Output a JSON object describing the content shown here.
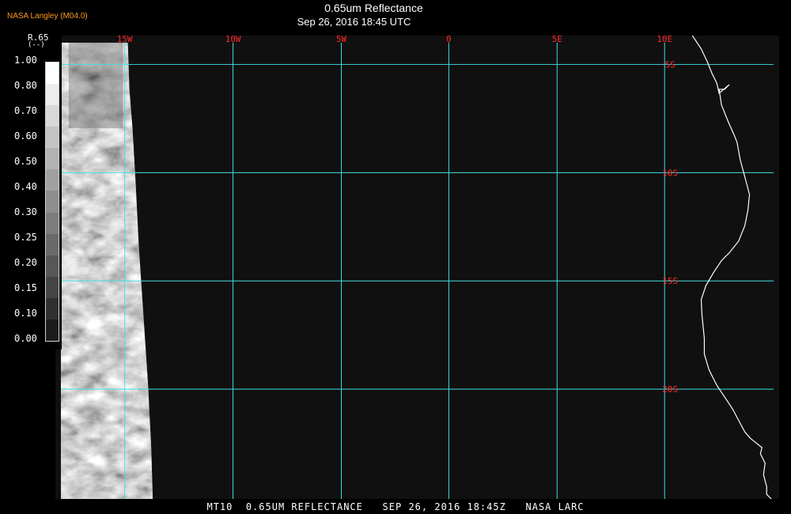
{
  "header": {
    "credit": "NASA Langley (M04.0)",
    "title": "0.65um Reflectance",
    "subtitle": "Sep 26, 2016 18:45 UTC"
  },
  "map": {
    "grid_color": "#40e0e0",
    "label_color": "#ff2a2a",
    "coast_color": "#ffffff",
    "longitude_labels": [
      "15W",
      "10W",
      "5W",
      "0",
      "5E",
      "10E"
    ],
    "latitude_labels": [
      "5S",
      "10S",
      "15S",
      "20S"
    ]
  },
  "colorbar": {
    "title": "R.65",
    "unit": "(--)",
    "unit_marker": "(K)",
    "labels": [
      "1.00",
      "0.80",
      "0.70",
      "0.60",
      "0.50",
      "0.40",
      "0.30",
      "0.25",
      "0.20",
      "0.15",
      "0.10",
      "0.00"
    ],
    "swatch_colors": [
      "#ffffff",
      "#ececec",
      "#d8d8d8",
      "#c4c4c4",
      "#b2b2b2",
      "#a0a0a0",
      "#8e8e8e",
      "#7c7c7c",
      "#6a6a6a",
      "#575757",
      "#444444",
      "#303030",
      "#1c1c1c"
    ]
  },
  "footer": {
    "caption": "MT10  0.65UM REFLECTANCE   SEP 26, 2016 18:45Z   NASA LARC"
  }
}
